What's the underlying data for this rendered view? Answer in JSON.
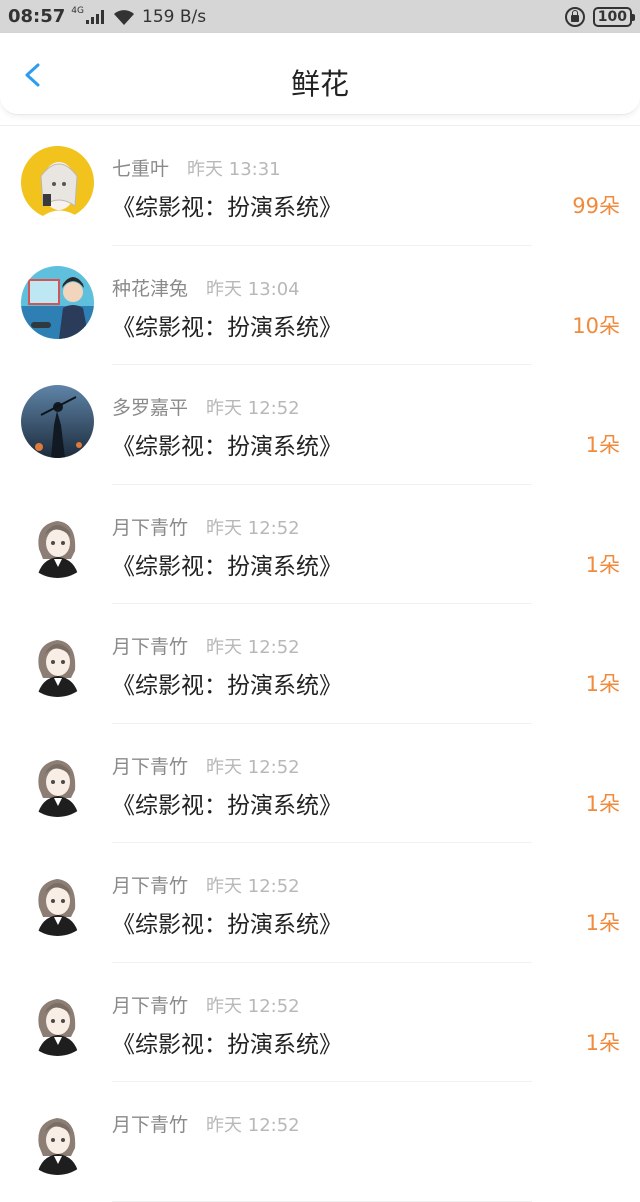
{
  "status_bar": {
    "time": "08:57",
    "network": "4G",
    "speed": "159 B/s",
    "battery": "100"
  },
  "header": {
    "title": "鲜花",
    "back_icon": "chevron-left-icon",
    "accent_color": "#2d9cf0"
  },
  "items": [
    {
      "user": "七重叶",
      "time": "昨天 13:31",
      "book": "《综影视：扮演系统》",
      "count": "99朵",
      "avatar": "yellow"
    },
    {
      "user": "种花津兔",
      "time": "昨天 13:04",
      "book": "《综影视：扮演系统》",
      "count": "10朵",
      "avatar": "sea"
    },
    {
      "user": "多罗嘉平",
      "time": "昨天 12:52",
      "book": "《综影视：扮演系统》",
      "count": "1朵",
      "avatar": "dark"
    },
    {
      "user": "月下青竹",
      "time": "昨天 12:52",
      "book": "《综影视：扮演系统》",
      "count": "1朵",
      "avatar": "girl"
    },
    {
      "user": "月下青竹",
      "time": "昨天 12:52",
      "book": "《综影视：扮演系统》",
      "count": "1朵",
      "avatar": "girl"
    },
    {
      "user": "月下青竹",
      "time": "昨天 12:52",
      "book": "《综影视：扮演系统》",
      "count": "1朵",
      "avatar": "girl"
    },
    {
      "user": "月下青竹",
      "time": "昨天 12:52",
      "book": "《综影视：扮演系统》",
      "count": "1朵",
      "avatar": "girl"
    },
    {
      "user": "月下青竹",
      "time": "昨天 12:52",
      "book": "《综影视：扮演系统》",
      "count": "1朵",
      "avatar": "girl"
    },
    {
      "user": "月下青竹",
      "time": "昨天 12:52",
      "book": "",
      "count": "",
      "avatar": "girl"
    }
  ],
  "colors": {
    "count": "#f08a3c",
    "status_bar_bg": "#d6d6d6"
  }
}
